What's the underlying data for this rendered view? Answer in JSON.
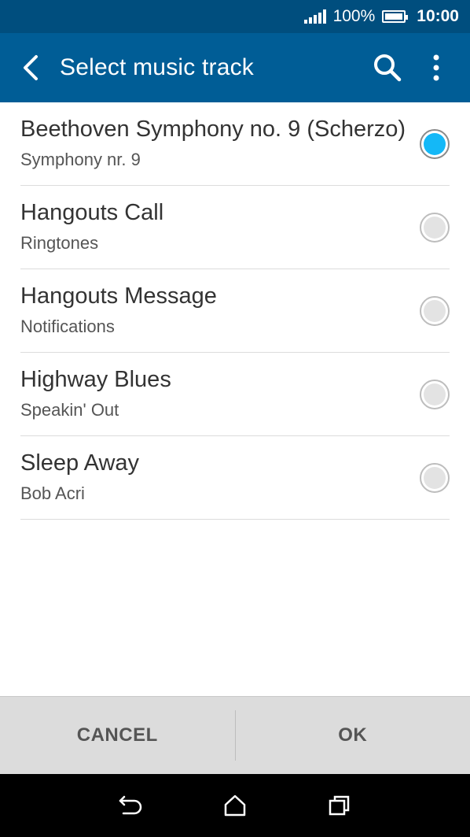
{
  "status_bar": {
    "battery_percent": "100%",
    "clock": "10:00",
    "icons": [
      "signal-icon",
      "battery-icon"
    ]
  },
  "app_bar": {
    "title": "Select music track",
    "icons": {
      "back": "back-arrow-icon",
      "search": "search-icon",
      "more": "more-vert-icon"
    }
  },
  "tracks": [
    {
      "title": "Beethoven Symphony no. 9 (Scherzo)",
      "subtitle": "Symphony nr. 9",
      "selected": true
    },
    {
      "title": "Hangouts Call",
      "subtitle": "Ringtones",
      "selected": false
    },
    {
      "title": "Hangouts Message",
      "subtitle": "Notifications",
      "selected": false
    },
    {
      "title": "Highway Blues",
      "subtitle": "Speakin' Out",
      "selected": false
    },
    {
      "title": "Sleep Away",
      "subtitle": "Bob Acri",
      "selected": false
    }
  ],
  "buttons": {
    "cancel": "CANCEL",
    "ok": "OK"
  },
  "nav_bar": {
    "icons": [
      "back-icon",
      "home-icon",
      "recents-icon"
    ]
  },
  "colors": {
    "status_bar": "#004e7e",
    "app_bar": "#005d96",
    "radio_selected": "#14b8f7",
    "button_bar": "#dcdcdc"
  }
}
